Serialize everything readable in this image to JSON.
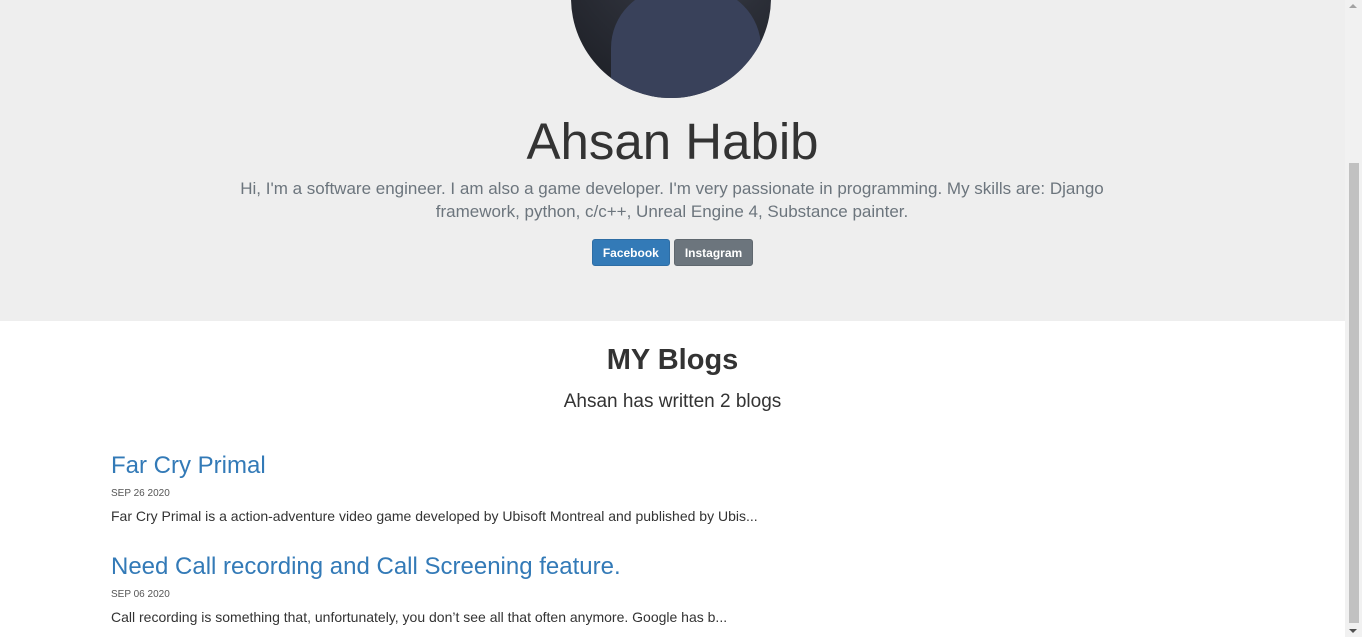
{
  "profile": {
    "name": "Ahsan Habib",
    "bio": "Hi, I'm a software engineer. I am also a game developer. I'm very passionate in programming. My skills are: Django framework, python, c/c++, Unreal Engine 4, Substance painter.",
    "buttons": {
      "facebook": "Facebook",
      "instagram": "Instagram"
    }
  },
  "blogs": {
    "heading": "MY Blogs",
    "count_text": "Ahsan has written 2 blogs",
    "posts": [
      {
        "title": "Far Cry Primal",
        "date": "SEP 26 2020",
        "excerpt": "Far Cry Primal is a action-adventure video game developed by Ubisoft Montreal and published by Ubis..."
      },
      {
        "title": "Need Call recording and Call Screening feature.",
        "date": "SEP 06 2020",
        "excerpt": "Call recording is something that, unfortunately, you don’t see all that often anymore. Google has b..."
      }
    ]
  },
  "colors": {
    "hero_bg": "#eeeeee",
    "link": "#337ab7",
    "facebook_button": "#337ab7",
    "instagram_button": "#6c757d",
    "muted_text": "#6c757d"
  }
}
